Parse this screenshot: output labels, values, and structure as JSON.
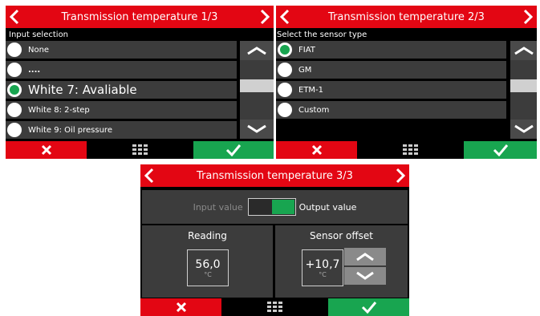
{
  "screen1": {
    "title": "Transmission temperature 1/3",
    "subtitle": "Input selection",
    "items": [
      {
        "label": "None",
        "selected": false
      },
      {
        "label": "....",
        "selected": false
      },
      {
        "label": "White 7: Avaliable",
        "selected": true
      },
      {
        "label": "White 8: 2-step",
        "selected": false
      },
      {
        "label": "White 9: Oil pressure",
        "selected": false
      }
    ]
  },
  "screen2": {
    "title": "Transmission temperature 2/3",
    "subtitle": "Select the sensor type",
    "items": [
      {
        "label": "FIAT",
        "selected": true
      },
      {
        "label": "GM",
        "selected": false
      },
      {
        "label": "ETM-1",
        "selected": false
      },
      {
        "label": "Custom",
        "selected": false
      }
    ]
  },
  "screen3": {
    "title": "Transmission temperature 3/3",
    "toggle": {
      "left_label": "Input value",
      "right_label": "Output value",
      "state": "output"
    },
    "reading": {
      "label": "Reading",
      "value": "56,0",
      "unit": "°C"
    },
    "offset": {
      "label": "Sensor offset",
      "value": "+10,7",
      "unit": "°C"
    }
  },
  "icons": {
    "prev": "chevron-left-icon",
    "next": "chevron-right-icon",
    "up": "chevron-up-icon",
    "down": "chevron-down-icon",
    "cancel": "x-icon",
    "menu": "grid-icon",
    "confirm": "check-icon"
  },
  "colors": {
    "accent_red": "#e30613",
    "accent_green": "#18a550",
    "item_bg": "#3c3c3c",
    "background": "#000000"
  }
}
